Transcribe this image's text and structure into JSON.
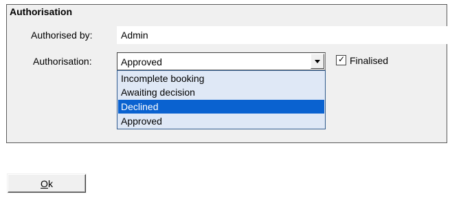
{
  "group": {
    "title": "Authorisation"
  },
  "authorised_by": {
    "label": "Authorised by:",
    "value": "Admin"
  },
  "authorisation": {
    "label": "Authorisation:",
    "selected_value": "Approved",
    "dropdown_open": true,
    "highlighted_option": "Declined",
    "options": [
      "Incomplete booking",
      "Awaiting decision",
      "Declined",
      "Approved"
    ]
  },
  "finalised": {
    "label": "Finalised",
    "checked": true
  },
  "ok_button": {
    "label_underlined": "O",
    "label_rest": "k"
  },
  "colors": {
    "highlight": "#0a62d0",
    "list_background": "#dfe8f6",
    "panel_background": "#f0f0f0"
  },
  "icons": {
    "combo_arrow": "chevron-down-icon",
    "checkmark": "checkmark-icon"
  }
}
